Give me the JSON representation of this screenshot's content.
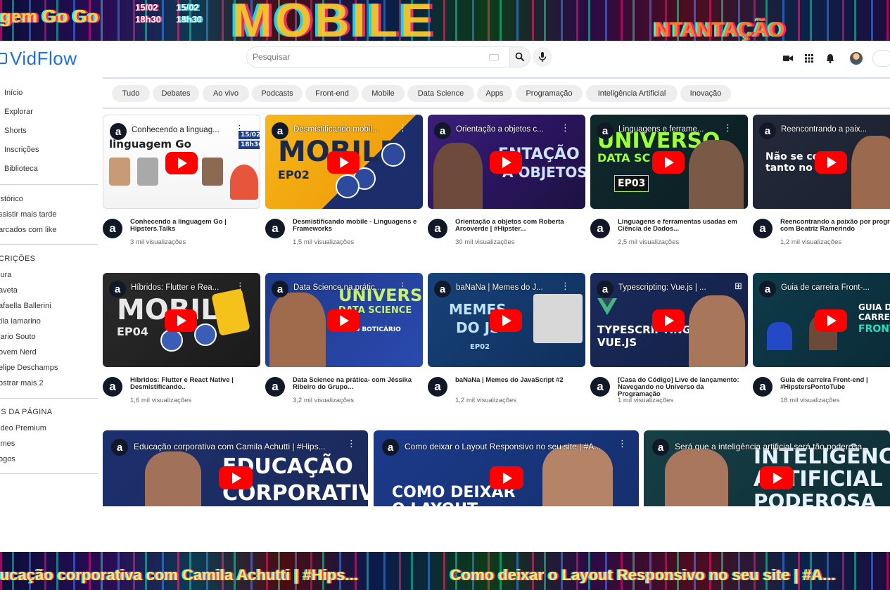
{
  "banner": {
    "top_text_1": "gem Go Go",
    "top_date_1": "15/02",
    "top_time_1": "18h30",
    "top_date_2": "15/02",
    "top_time_2": "18h30",
    "top_big": "MOBILE",
    "top_right": "NTANTAÇÃO",
    "bottom_text_1": "ucação corporativa com Camila Achutti | #Hips...",
    "bottom_text_2": "Como deixar o Layout Responsivo no seu site | #A..."
  },
  "header": {
    "brand": "VidFlow",
    "search_placeholder": "Pesquisar",
    "icons": [
      "video-camera-icon",
      "apps-grid-icon",
      "bell-icon",
      "avatar",
      "theme-switch"
    ]
  },
  "sidebar": {
    "main": [
      "Início",
      "Explorar",
      "Shorts",
      "Inscrições",
      "Biblioteca"
    ],
    "library": [
      "istórico",
      "ssistir mais tarde",
      "arcados com like"
    ],
    "subs_title": "CRIÇÕES",
    "subs": [
      "lura",
      "aveta",
      "afaella Ballerini",
      "tila Iamarino",
      "lario Souto",
      "ovem Nerd",
      "elipe Deschamps",
      "ostrar mais 2"
    ],
    "more_title": "IS DA PÁGINA",
    "more": [
      "ideo Premium",
      "lmes",
      "ogos"
    ]
  },
  "chips": [
    "Tudo",
    "Debates",
    "Ao vivo",
    "Podcasts",
    "Front-end",
    "Mobile",
    "Data Science",
    "Apps",
    "Programação",
    "Inteligência Artificial",
    "Inovação"
  ],
  "videos": [
    {
      "overlay": "Conhecendo a linguag...",
      "title": "Conhecendo a linguagem Go | Hipsters.Talks",
      "views": "3 mil visualizações",
      "big": "linguagem Go",
      "date": "15/02",
      "time": "18h30"
    },
    {
      "overlay": "Desmistificando mobil...",
      "title": "Desmistificando mobile - Linguagens e Frameworks",
      "views": "1,5 mil visualizações",
      "big": "MOBILE",
      "sub": "EP02"
    },
    {
      "overlay": "Orientação a objetos c...",
      "title": "Orientação a objetos com Roberta Arcoverde | #Hipster...",
      "views": "30 mil visualizações",
      "big": "ENTAÇÃO",
      "sub": "A OBJETOS"
    },
    {
      "overlay": "Linguagens e ferrame...",
      "title": "Linguagens e ferramentas usadas em Ciência de Dados...",
      "views": "2,5 mil visualizações",
      "big": "UNIVERSO",
      "sub": "DATA SC",
      "tag": "EP03"
    },
    {
      "overlay": "Reencontrando a paix...",
      "title": "Reencontrando a paixão por programar com Beatriz Ramerindo",
      "views": "1,2 mil visualizações",
      "big": "Não se co",
      "sub": "tanto no i"
    },
    {
      "overlay": "Híbridos: Flutter e Rea...",
      "title": "Híbridos: Flutter e React Native | Desmistificando..",
      "views": "1,6 mil visualizações",
      "big": "MOBILE",
      "sub": "EP04"
    },
    {
      "overlay": "Data Science na prátic...",
      "title": "Data Science na prática- com Jéssika Ribeiro do Grupo...",
      "views": "3,2 mil visualizações",
      "big": "UNIVERSO",
      "sub": "DATA SCIENCE",
      "tag": "o BOTICÁRIO"
    },
    {
      "overlay": "baNaNa | Memes do J...",
      "title": "baNaNa | Memes do JavaScript #2",
      "views": "1,2 mil visualizações",
      "big": "MEMES",
      "sub": "DO JS",
      "tag": "EP02"
    },
    {
      "overlay": "Typescripting: Vue.js | ...",
      "title": "[Casa do Código] Live de lançamento: Navegando no Universo da Programação",
      "views": "1 mil visualizações",
      "big": "TYPESCRIPTING:",
      "sub": "VUE.JS"
    },
    {
      "overlay": "Guia de carreira Front-...",
      "title": "Guia de carreira Front-end | #HipstersPontoTube",
      "views": "18 mil visualizações",
      "big": "GUIA DE",
      "sub": "CARREIRA",
      "tag": "FRONT END"
    }
  ],
  "wide": [
    {
      "overlay": "Educação corporativa com Camila Achutti | #Hips...",
      "big": "EDUCAÇÃO",
      "sub": "CORPORATIVA"
    },
    {
      "overlay": "Como deixar o Layout Responsivo no seu site | #A...",
      "big": "COMO DEIXAR",
      "sub": "O LAYOUT"
    },
    {
      "overlay": "Será que a inteligência artificial será tão poderosa...",
      "big": "INTELIGÊNCIA",
      "sub": "ARTIFICIAL",
      "tag": "PODEROSA"
    }
  ]
}
